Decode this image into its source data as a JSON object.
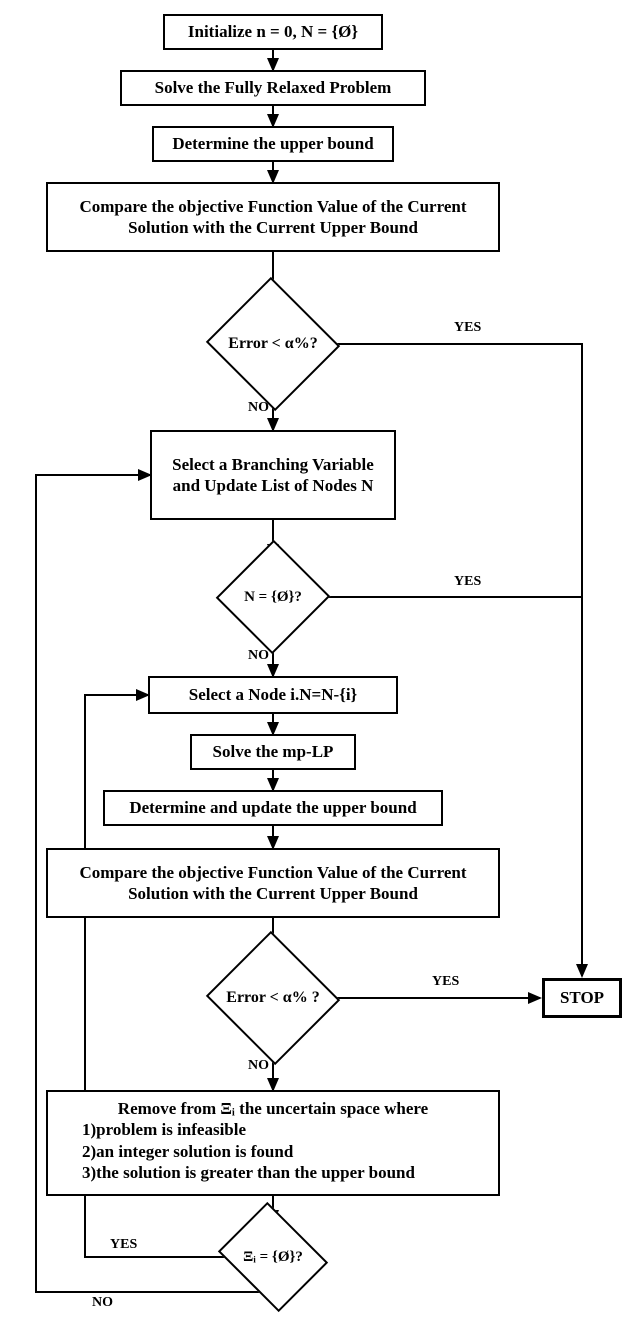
{
  "nodes": {
    "init": "Initialize n = 0, N = {Ø}",
    "solve_relaxed": "Solve the Fully Relaxed Problem",
    "det_upper": "Determine the upper bound",
    "compare1": "Compare the objective Function Value of the Current Solution with the Current Upper Bound",
    "dec1": "Error < α%?",
    "branch": "Select a Branching Variable and Update List of Nodes N",
    "dec2": "N = {Ø}?",
    "select_node": "Select a Node i.N=N-{i}",
    "solve_mplp": "Solve the mp-LP",
    "det_update": "Determine and update the upper bound",
    "compare2": "Compare the objective Function Value of the Current Solution with the Current Upper Bound",
    "dec3": "Error < α% ?",
    "remove_text_l1": "Remove from Ξᵢ the uncertain space where",
    "remove_text_l2": "1)problem is infeasible",
    "remove_text_l3": "2)an integer solution is found",
    "remove_text_l4": "3)the solution is greater than the upper bound",
    "dec4": "Ξᵢ  = {Ø}?",
    "stop": "STOP"
  },
  "labels": {
    "yes": "YES",
    "no": "NO"
  }
}
